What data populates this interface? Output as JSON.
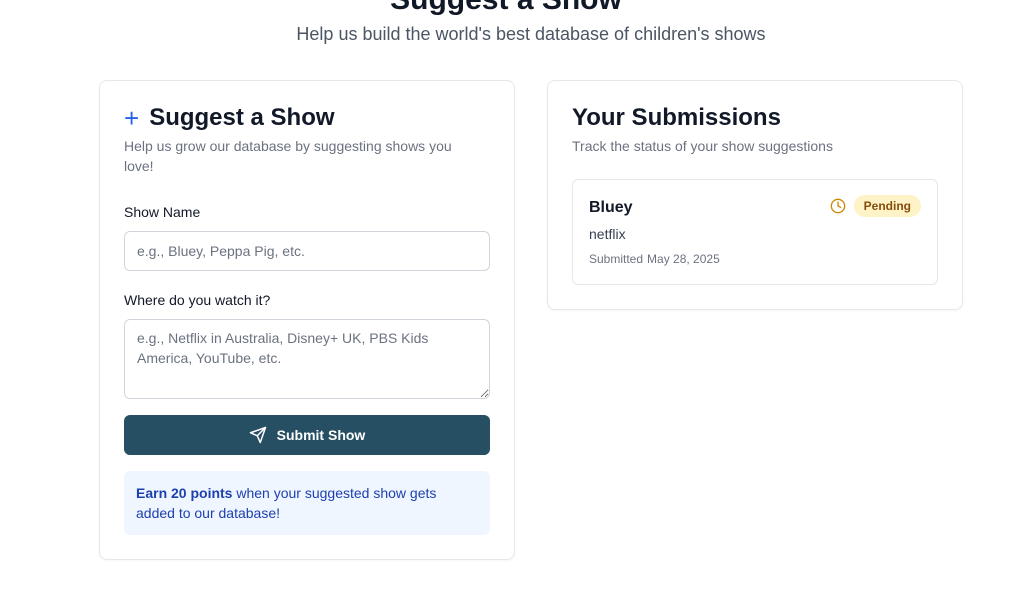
{
  "header": {
    "title": "Suggest a Show",
    "subtitle": "Help us build the world's best database of children's shows"
  },
  "suggest_form": {
    "title": "Suggest a Show",
    "icon": "plus-icon",
    "description": "Help us grow our database by suggesting shows you love!",
    "show_name_label": "Show Name",
    "show_name_placeholder": "e.g., Bluey, Peppa Pig, etc.",
    "show_name_value": "",
    "where_label": "Where do you watch it?",
    "where_placeholder": "e.g., Netflix in Australia, Disney+ UK, PBS Kids America, YouTube, etc.",
    "where_value": "",
    "submit_label": "Submit Show",
    "submit_icon": "send-icon",
    "points_strong": "Earn 20 points",
    "points_rest": " when your suggested show gets added to our database!"
  },
  "submissions": {
    "title": "Your Submissions",
    "description": "Track the status of your show suggestions",
    "items": [
      {
        "show_name": "Bluey",
        "platform": "netflix",
        "submitted_prefix": "Submitted",
        "submitted_date": "May 28, 2025",
        "status": "Pending",
        "status_icon": "clock-icon"
      }
    ]
  },
  "colors": {
    "accent_blue": "#2563eb",
    "button_bg": "#264f63",
    "pending_bg": "#fef3c7",
    "pending_text": "#854d0e",
    "clock_color": "#ca8a04",
    "info_bg": "#eff6ff",
    "info_text": "#1e40af"
  }
}
